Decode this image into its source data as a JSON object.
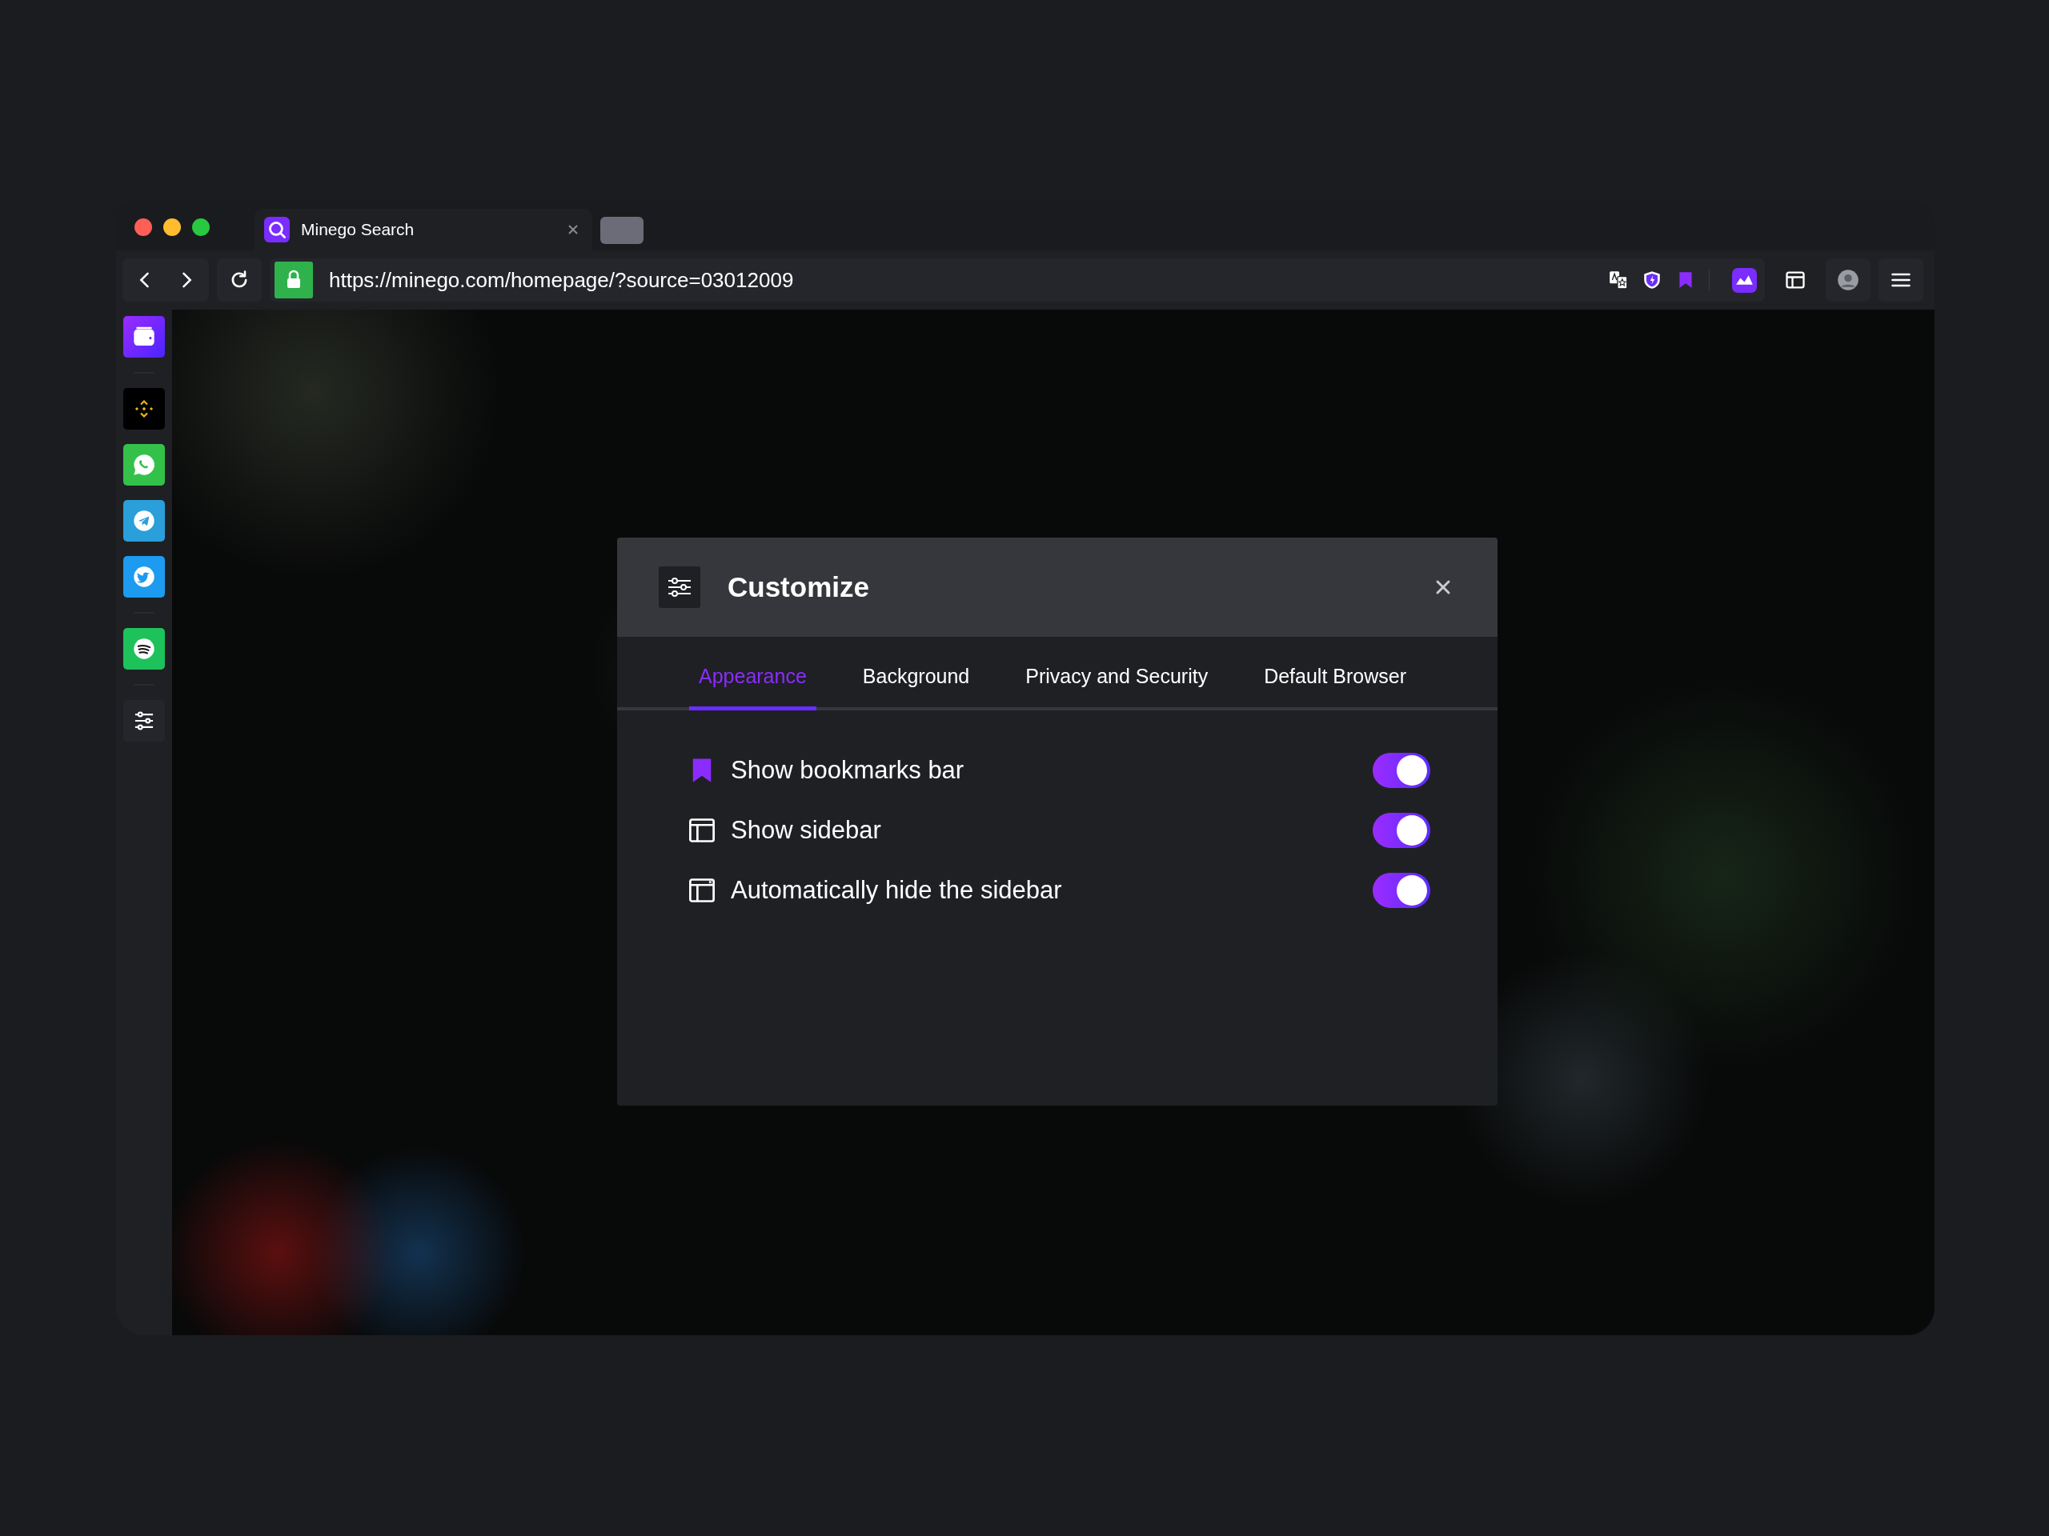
{
  "browser": {
    "tab": {
      "title": "Minego Search"
    },
    "address_bar": {
      "value": "https://minego.com/homepage/?source=03012009"
    }
  },
  "sidebar": {
    "items": [
      {
        "kind": "wallet"
      },
      {
        "kind": "binance"
      },
      {
        "kind": "whatsapp"
      },
      {
        "kind": "telegram"
      },
      {
        "kind": "twitter"
      },
      {
        "kind": "spotify"
      },
      {
        "kind": "settings"
      }
    ]
  },
  "dialog": {
    "title": "Customize",
    "tabs": [
      {
        "label": "Appearance",
        "selected": true
      },
      {
        "label": "Background",
        "selected": false
      },
      {
        "label": "Privacy and Security",
        "selected": false
      },
      {
        "label": "Default Browser",
        "selected": false
      }
    ],
    "settings": [
      {
        "kind": "bookmark",
        "label": "Show bookmarks bar",
        "on": true
      },
      {
        "kind": "sidebar",
        "label": "Show sidebar",
        "on": true
      },
      {
        "kind": "autohide",
        "label": "Automatically hide the sidebar",
        "on": true
      }
    ]
  }
}
